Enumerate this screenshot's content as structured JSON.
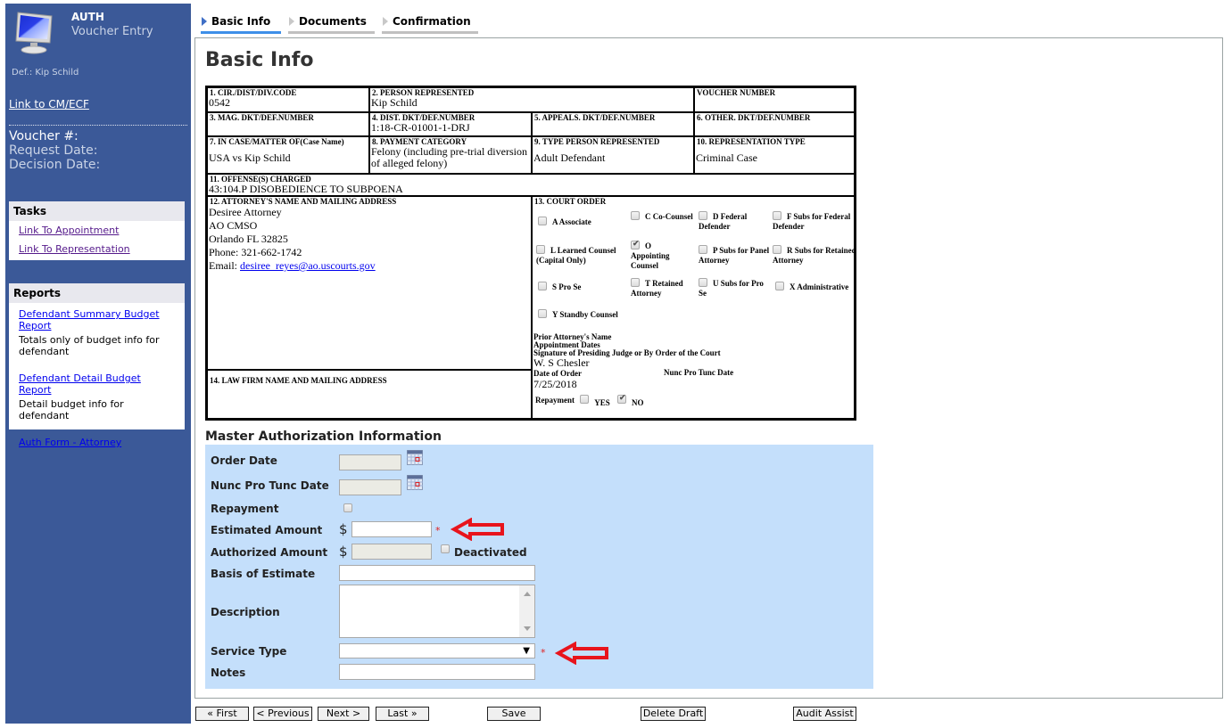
{
  "sidebar": {
    "app_name": "AUTH",
    "app_subtitle": "Voucher Entry",
    "defendant": "Def.: Kip Schild",
    "cmecf_link": "Link to CM/ECF",
    "voucher_label": "Voucher #:",
    "request_date_label": "Request Date:",
    "decision_date_label": "Decision Date:",
    "tasks": {
      "title": "Tasks",
      "items": [
        {
          "label": "Link To Appointment"
        },
        {
          "label": "Link To Representation"
        }
      ]
    },
    "reports": {
      "title": "Reports",
      "items": [
        {
          "label": "Defendant Summary Budget Report",
          "description": "Totals only of budget info for defendant"
        },
        {
          "label": "Defendant Detail Budget Report",
          "description": "Detail budget info for defendant"
        },
        {
          "label": "Auth Form - Attorney",
          "description": ""
        }
      ]
    }
  },
  "tabs": [
    {
      "label": "Basic Info",
      "active": true
    },
    {
      "label": "Documents",
      "active": false
    },
    {
      "label": "Confirmation",
      "active": false
    }
  ],
  "page_title": "Basic Info",
  "form": {
    "f1": {
      "label": "1. CIR./DIST/DIV.CODE",
      "value": "0542"
    },
    "f2": {
      "label": "2. PERSON REPRESENTED",
      "value": "Kip Schild"
    },
    "voucher": {
      "label": "VOUCHER NUMBER",
      "value": ""
    },
    "f3": {
      "label": "3. MAG. DKT/DEF.NUMBER",
      "value": ""
    },
    "f4": {
      "label": "4. DIST. DKT/DEF.NUMBER",
      "value": "1:18-CR-01001-1-DRJ"
    },
    "f5": {
      "label": "5. APPEALS. DKT/DEF.NUMBER",
      "value": ""
    },
    "f6": {
      "label": "6. OTHER. DKT/DEF.NUMBER",
      "value": ""
    },
    "f7": {
      "label": "7. IN CASE/MATTER OF(Case Name)",
      "value": "USA vs Kip Schild"
    },
    "f8": {
      "label": "8. PAYMENT CATEGORY",
      "value": "Felony (including pre-trial diversion of alleged felony)"
    },
    "f9": {
      "label": "9. TYPE PERSON REPRESENTED",
      "value": "Adult Defendant"
    },
    "f10": {
      "label": "10. REPRESENTATION TYPE",
      "value": "Criminal Case"
    },
    "f11": {
      "label": "11. OFFENSE(S) CHARGED",
      "value": "43:104.P DISOBEDIENCE TO SUBPOENA"
    },
    "f12": {
      "label": "12. ATTORNEY'S NAME AND MAILING ADDRESS",
      "name": "Desiree Attorney",
      "org": "AO CMSO",
      "city": "Orlando FL 32825",
      "phone": "Phone: 321-662-1742",
      "email_label": "Email:",
      "email": "desiree_reyes@ao.uscourts.gov"
    },
    "f13": {
      "label": "13. COURT ORDER",
      "options": [
        {
          "label": "A Associate",
          "checked": false
        },
        {
          "label": "C Co-Counsel",
          "checked": false
        },
        {
          "label": "D Federal Defender",
          "checked": false
        },
        {
          "label": "F Subs for Federal Defender",
          "checked": false
        },
        {
          "label": "L Learned Counsel (Capital Only)",
          "checked": false
        },
        {
          "label": "O Appointing Counsel",
          "checked": true
        },
        {
          "label": "P Subs for Panel Attorney",
          "checked": false
        },
        {
          "label": "R Subs for Retained Attorney",
          "checked": false
        },
        {
          "label": "S Pro Se",
          "checked": false
        },
        {
          "label": "T Retained Attorney",
          "checked": false
        },
        {
          "label": "U Subs for Pro Se",
          "checked": false
        },
        {
          "label": "X Administrative",
          "checked": false
        },
        {
          "label": "Y Standby Counsel",
          "checked": false
        }
      ],
      "prior_attorney_label": "Prior Attorney's Name",
      "appointment_dates_label": "Appointment Dates",
      "signature_label": "Signature of Presiding Judge or By Order of the Court",
      "signature_value": "W. S Chesler",
      "date_of_order_label": "Date of Order",
      "date_of_order_value": "7/25/2018",
      "nunc_label": "Nunc Pro Tunc Date",
      "repayment_label": "Repayment",
      "repayment_yes": "YES",
      "repayment_no": "NO",
      "repayment_yes_checked": false,
      "repayment_no_checked": true
    },
    "f14": {
      "label": "14. LAW FIRM NAME AND MAILING ADDRESS",
      "value": ""
    }
  },
  "master_auth": {
    "title": "Master Authorization Information",
    "order_date_label": "Order Date",
    "order_date_value": "",
    "nunc_label": "Nunc Pro Tunc Date",
    "nunc_value": "",
    "repayment_label": "Repayment",
    "repayment_checked": false,
    "estimated_label": "Estimated Amount",
    "estimated_value": "",
    "authorized_label": "Authorized Amount",
    "authorized_value": "",
    "currency": "$",
    "deactivated_label": "Deactivated",
    "basis_label": "Basis of Estimate",
    "basis_value": "",
    "description_label": "Description",
    "description_value": "",
    "service_type_label": "Service Type",
    "service_type_value": "",
    "notes_label": "Notes",
    "notes_value": "",
    "required_marker": "*",
    "annotation_color": "#e8141c"
  },
  "buttons": {
    "first": "« First",
    "previous": "< Previous",
    "next": "Next >",
    "last": "Last »",
    "save": "Save",
    "delete_draft": "Delete Draft",
    "audit_assist": "Audit Assist"
  }
}
